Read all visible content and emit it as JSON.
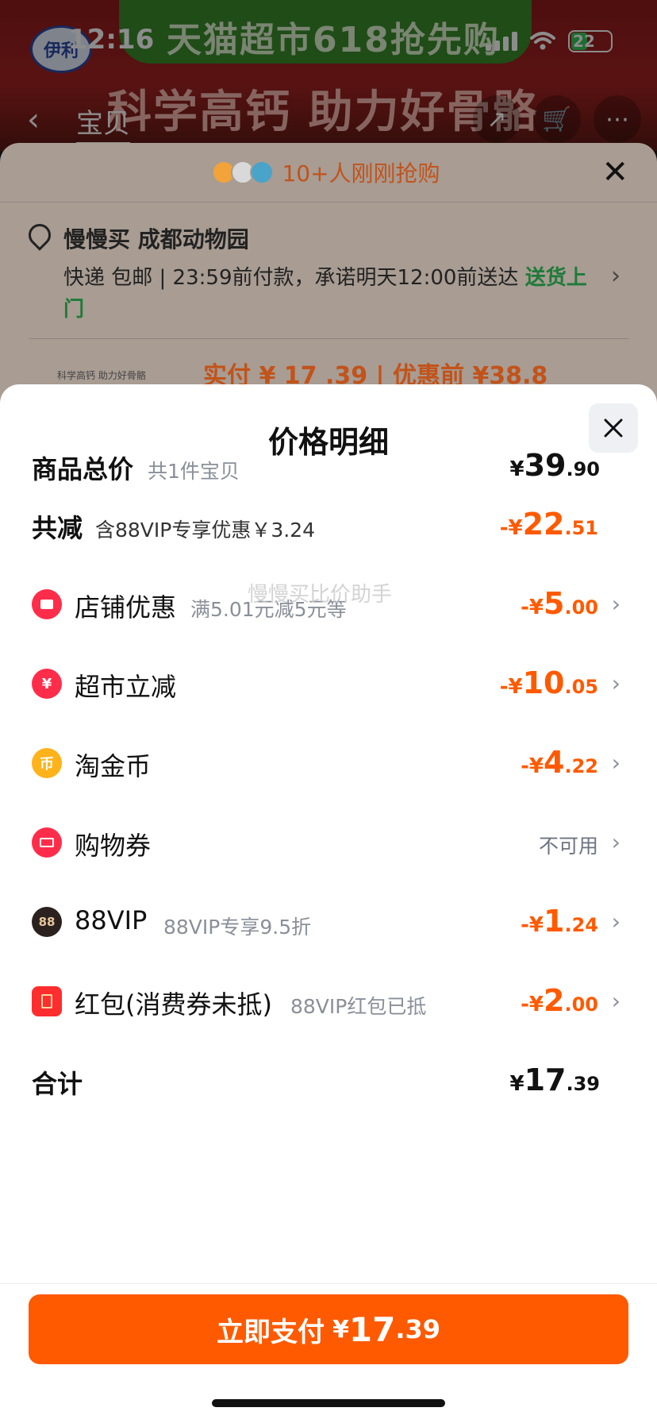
{
  "status_bar": {
    "time": "12:16",
    "battery": "22"
  },
  "background": {
    "banner_top": "天猫超市618抢先购",
    "banner_slogan": "科学高钙 助力好骨骼",
    "brand_logo": "伊利",
    "nav_tab": "宝贝"
  },
  "order_sheet": {
    "header": "10+人刚刚抢购",
    "address": "慢慢买 成都动物园",
    "shipping_prefix": "快递 包邮 | 23:59前付款，承诺明天12:00前送达 ",
    "shipping_highlight": "送货上门",
    "thumb_text": "科学高钙 助力好骨骼",
    "price_peek": "实付 ¥ 17 .39 | 优惠前 ¥38.8"
  },
  "price_detail": {
    "title": "价格明细",
    "watermark": "慢慢买比价助手",
    "rows": [
      {
        "label": "商品总价",
        "sub": "共1件宝贝",
        "cur": "¥",
        "int": "39",
        "dec": ".90"
      },
      {
        "label": "共减",
        "sub": "含88VIP专享优惠￥3.24",
        "cur": "-¥",
        "int": "22",
        "dec": ".51"
      },
      {
        "label": "店铺优惠",
        "sub": "满5.01元减5元等",
        "cur": "-¥",
        "int": "5",
        "dec": ".00",
        "icon": "shop-coupon-icon"
      },
      {
        "label": "超市立减",
        "sub": "",
        "cur": "-¥",
        "int": "10",
        "dec": ".05",
        "icon": "yen-discount-icon"
      },
      {
        "label": "淘金币",
        "sub": "",
        "cur": "-¥",
        "int": "4",
        "dec": ".22",
        "icon": "gold-coin-icon"
      },
      {
        "label": "购物券",
        "sub": "",
        "value_text": "不可用",
        "icon": "ticket-icon"
      },
      {
        "label": "88VIP",
        "sub": "88VIP专享9.5折",
        "cur": "-¥",
        "int": "1",
        "dec": ".24",
        "icon": "88vip-icon"
      },
      {
        "label": "红包(消费券未抵)",
        "sub": "88VIP红包已抵",
        "cur": "-¥",
        "int": "2",
        "dec": ".00",
        "icon": "red-packet-icon"
      },
      {
        "label": "合计",
        "sub": "",
        "cur": "¥",
        "int": "17",
        "dec": ".39"
      }
    ],
    "pay_button": {
      "label": "立即支付",
      "cur": "¥",
      "int": "17",
      "dec": ".39"
    }
  },
  "colors": {
    "accent": "#ff5a00",
    "text": "#111111",
    "muted": "#8a8f99"
  }
}
